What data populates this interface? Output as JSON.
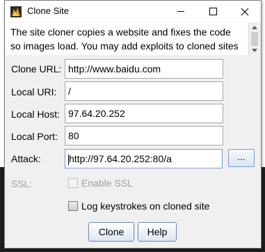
{
  "window": {
    "title": "Clone Site"
  },
  "description": {
    "lines": [
      "The site cloner copies a website and fixes the code",
      "so images load. You may add exploits to cloned sites"
    ]
  },
  "form": {
    "clone_url": {
      "label": "Clone URL:",
      "value": "http://www.baidu.com"
    },
    "local_uri": {
      "label": "Local URI:",
      "value": "/"
    },
    "local_host": {
      "label": "Local Host:",
      "value": "97.64.20.252"
    },
    "local_port": {
      "label": "Local Port:",
      "value": "80"
    },
    "attack": {
      "label": "Attack:",
      "value": "http://97.64.20.252:80/a",
      "browse_label": "..."
    },
    "ssl": {
      "label": "SSL:",
      "checkbox_label": "Enable SSL",
      "checked": false,
      "enabled": false
    },
    "log_keystrokes": {
      "checkbox_label": "Log keystrokes on cloned site",
      "checked": false
    }
  },
  "buttons": {
    "clone": "Clone",
    "help": "Help"
  },
  "colors": {
    "accent_border": "#7a9ccf",
    "disabled_text": "#a0a0a0"
  }
}
